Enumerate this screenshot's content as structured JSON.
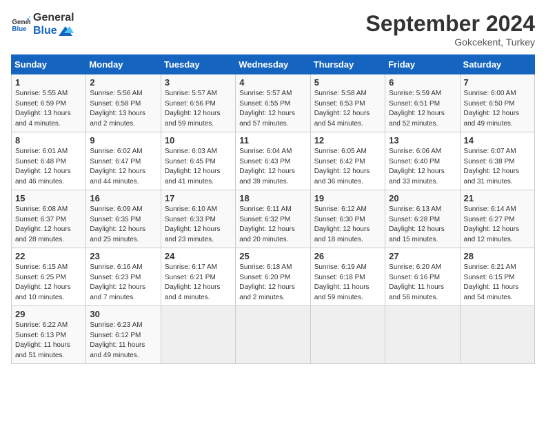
{
  "header": {
    "logo_line1": "General",
    "logo_line2": "Blue",
    "month_year": "September 2024",
    "location": "Gokcekent, Turkey"
  },
  "weekdays": [
    "Sunday",
    "Monday",
    "Tuesday",
    "Wednesday",
    "Thursday",
    "Friday",
    "Saturday"
  ],
  "weeks": [
    [
      {
        "day": "1",
        "info": "Sunrise: 5:55 AM\nSunset: 6:59 PM\nDaylight: 13 hours\nand 4 minutes."
      },
      {
        "day": "2",
        "info": "Sunrise: 5:56 AM\nSunset: 6:58 PM\nDaylight: 13 hours\nand 2 minutes."
      },
      {
        "day": "3",
        "info": "Sunrise: 5:57 AM\nSunset: 6:56 PM\nDaylight: 12 hours\nand 59 minutes."
      },
      {
        "day": "4",
        "info": "Sunrise: 5:57 AM\nSunset: 6:55 PM\nDaylight: 12 hours\nand 57 minutes."
      },
      {
        "day": "5",
        "info": "Sunrise: 5:58 AM\nSunset: 6:53 PM\nDaylight: 12 hours\nand 54 minutes."
      },
      {
        "day": "6",
        "info": "Sunrise: 5:59 AM\nSunset: 6:51 PM\nDaylight: 12 hours\nand 52 minutes."
      },
      {
        "day": "7",
        "info": "Sunrise: 6:00 AM\nSunset: 6:50 PM\nDaylight: 12 hours\nand 49 minutes."
      }
    ],
    [
      {
        "day": "8",
        "info": "Sunrise: 6:01 AM\nSunset: 6:48 PM\nDaylight: 12 hours\nand 46 minutes."
      },
      {
        "day": "9",
        "info": "Sunrise: 6:02 AM\nSunset: 6:47 PM\nDaylight: 12 hours\nand 44 minutes."
      },
      {
        "day": "10",
        "info": "Sunrise: 6:03 AM\nSunset: 6:45 PM\nDaylight: 12 hours\nand 41 minutes."
      },
      {
        "day": "11",
        "info": "Sunrise: 6:04 AM\nSunset: 6:43 PM\nDaylight: 12 hours\nand 39 minutes."
      },
      {
        "day": "12",
        "info": "Sunrise: 6:05 AM\nSunset: 6:42 PM\nDaylight: 12 hours\nand 36 minutes."
      },
      {
        "day": "13",
        "info": "Sunrise: 6:06 AM\nSunset: 6:40 PM\nDaylight: 12 hours\nand 33 minutes."
      },
      {
        "day": "14",
        "info": "Sunrise: 6:07 AM\nSunset: 6:38 PM\nDaylight: 12 hours\nand 31 minutes."
      }
    ],
    [
      {
        "day": "15",
        "info": "Sunrise: 6:08 AM\nSunset: 6:37 PM\nDaylight: 12 hours\nand 28 minutes."
      },
      {
        "day": "16",
        "info": "Sunrise: 6:09 AM\nSunset: 6:35 PM\nDaylight: 12 hours\nand 25 minutes."
      },
      {
        "day": "17",
        "info": "Sunrise: 6:10 AM\nSunset: 6:33 PM\nDaylight: 12 hours\nand 23 minutes."
      },
      {
        "day": "18",
        "info": "Sunrise: 6:11 AM\nSunset: 6:32 PM\nDaylight: 12 hours\nand 20 minutes."
      },
      {
        "day": "19",
        "info": "Sunrise: 6:12 AM\nSunset: 6:30 PM\nDaylight: 12 hours\nand 18 minutes."
      },
      {
        "day": "20",
        "info": "Sunrise: 6:13 AM\nSunset: 6:28 PM\nDaylight: 12 hours\nand 15 minutes."
      },
      {
        "day": "21",
        "info": "Sunrise: 6:14 AM\nSunset: 6:27 PM\nDaylight: 12 hours\nand 12 minutes."
      }
    ],
    [
      {
        "day": "22",
        "info": "Sunrise: 6:15 AM\nSunset: 6:25 PM\nDaylight: 12 hours\nand 10 minutes."
      },
      {
        "day": "23",
        "info": "Sunrise: 6:16 AM\nSunset: 6:23 PM\nDaylight: 12 hours\nand 7 minutes."
      },
      {
        "day": "24",
        "info": "Sunrise: 6:17 AM\nSunset: 6:21 PM\nDaylight: 12 hours\nand 4 minutes."
      },
      {
        "day": "25",
        "info": "Sunrise: 6:18 AM\nSunset: 6:20 PM\nDaylight: 12 hours\nand 2 minutes."
      },
      {
        "day": "26",
        "info": "Sunrise: 6:19 AM\nSunset: 6:18 PM\nDaylight: 11 hours\nand 59 minutes."
      },
      {
        "day": "27",
        "info": "Sunrise: 6:20 AM\nSunset: 6:16 PM\nDaylight: 11 hours\nand 56 minutes."
      },
      {
        "day": "28",
        "info": "Sunrise: 6:21 AM\nSunset: 6:15 PM\nDaylight: 11 hours\nand 54 minutes."
      }
    ],
    [
      {
        "day": "29",
        "info": "Sunrise: 6:22 AM\nSunset: 6:13 PM\nDaylight: 11 hours\nand 51 minutes."
      },
      {
        "day": "30",
        "info": "Sunrise: 6:23 AM\nSunset: 6:12 PM\nDaylight: 11 hours\nand 49 minutes."
      },
      {
        "day": "",
        "info": ""
      },
      {
        "day": "",
        "info": ""
      },
      {
        "day": "",
        "info": ""
      },
      {
        "day": "",
        "info": ""
      },
      {
        "day": "",
        "info": ""
      }
    ]
  ]
}
